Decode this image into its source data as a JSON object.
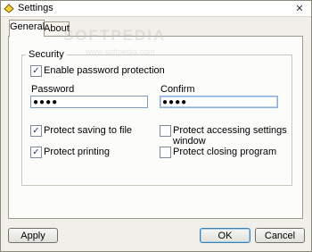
{
  "window": {
    "title": "Settings",
    "close_glyph": "✕"
  },
  "tabs": [
    {
      "label": "General",
      "active": true
    },
    {
      "label": "About",
      "active": false
    }
  ],
  "security": {
    "group_label": "Security",
    "enable_password": {
      "label": "Enable password protection",
      "checked": true
    },
    "password": {
      "label": "Password",
      "value": "●●●●"
    },
    "confirm": {
      "label": "Confirm",
      "value": "●●●●"
    },
    "options": {
      "protect_saving": {
        "label": "Protect saving to file",
        "checked": true
      },
      "protect_printing": {
        "label": "Protect printing",
        "checked": true
      },
      "protect_settings": {
        "label": "Protect accessing settings window",
        "checked": false
      },
      "protect_closing": {
        "label": "Protect closing program",
        "checked": false
      }
    }
  },
  "buttons": {
    "apply": "Apply",
    "ok": "OK",
    "cancel": "Cancel"
  },
  "watermark": {
    "text": "SOFTPEDIA",
    "sub": "www.softpedia.com"
  },
  "colors": {
    "check": "#1f3a66",
    "focus_border": "#8aaed7"
  }
}
